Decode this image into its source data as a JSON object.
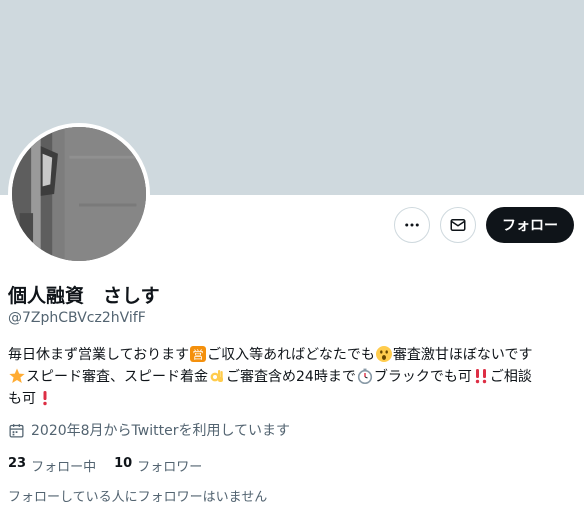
{
  "profile": {
    "display_name": "個人融資　さしす",
    "handle": "@7ZphCBVcz2hVifF"
  },
  "actions": {
    "more_icon": "more-horizontal-icon",
    "message_icon": "envelope-icon",
    "follow_label": "フォロー"
  },
  "bio": {
    "segments": [
      {
        "text": "毎日休まず営業しております"
      },
      {
        "emoji": "営"
      },
      {
        "text": "ご収入等あればどなたでも"
      },
      {
        "emoji": "astonished-face"
      },
      {
        "text": "審査激甘ほぼないです"
      },
      {
        "break": true
      },
      {
        "emoji": "star"
      },
      {
        "text": "スピード審査、スピード着金"
      },
      {
        "emoji": "ok-hand"
      },
      {
        "text": "ご審査含め24時まで"
      },
      {
        "emoji": "stopwatch"
      },
      {
        "text": "ブラックでも可"
      },
      {
        "emoji": "double-exclamation"
      },
      {
        "text": "ご相談"
      },
      {
        "break": true
      },
      {
        "text": "も可"
      },
      {
        "emoji": "exclamation"
      }
    ]
  },
  "joined": {
    "icon": "calendar-icon",
    "text": "2020年8月からTwitterを利用しています"
  },
  "stats": {
    "following_count": "23",
    "following_label": "フォロー中",
    "followers_count": "10",
    "followers_label": "フォロワー"
  },
  "no_followers_you_follow": "フォローしている人にフォロワーはいません",
  "colors": {
    "banner": "#cfd9de",
    "primary_text": "#0f1419",
    "secondary_text": "#536471",
    "follow_button_bg": "#0f1419"
  }
}
